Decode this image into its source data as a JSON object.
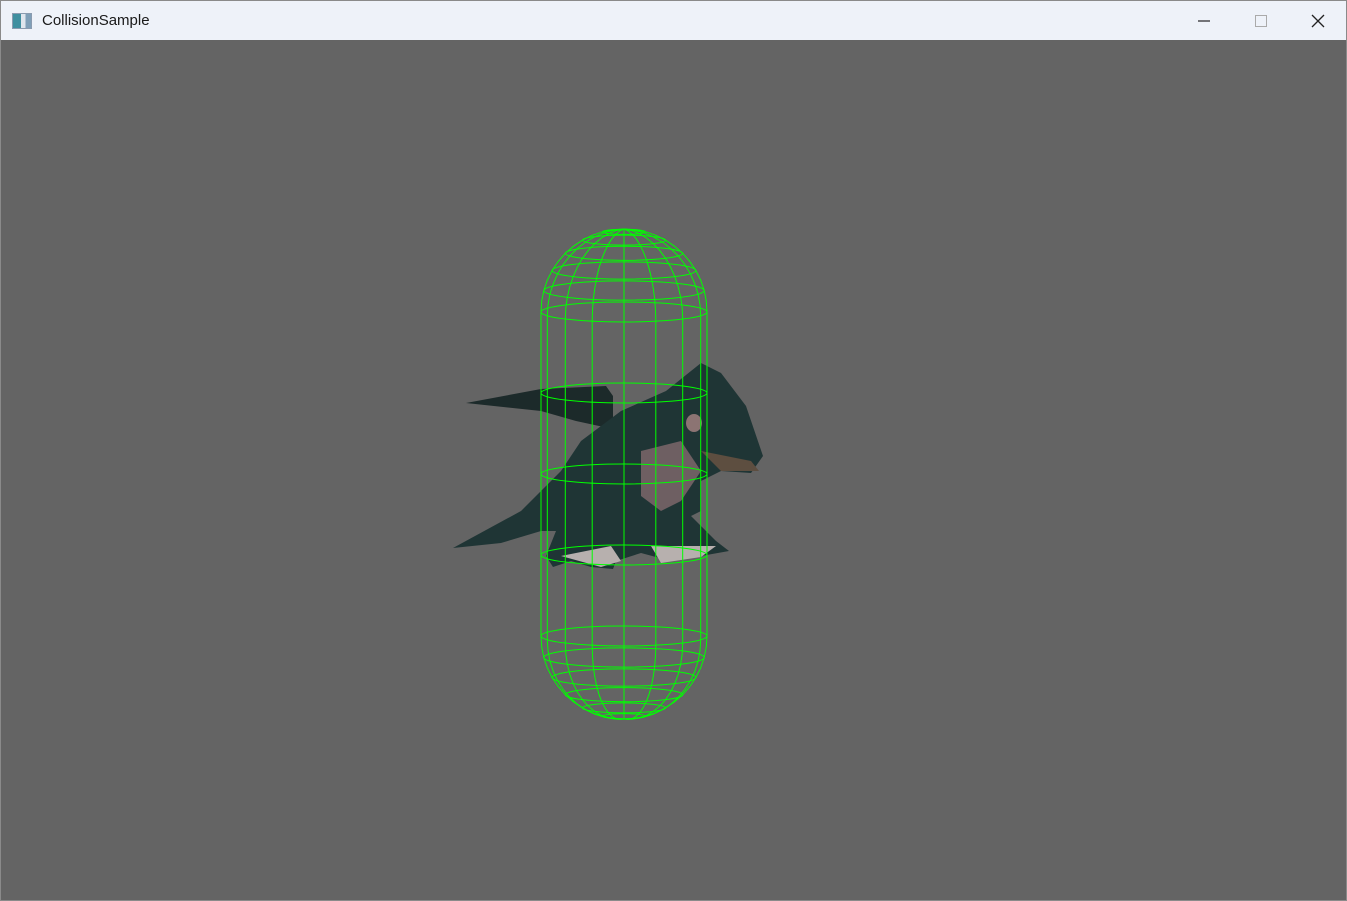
{
  "window": {
    "title": "CollisionSample",
    "icon": "app-window-icon"
  },
  "controls": {
    "minimize": "minimize-icon",
    "maximize": "maximize-icon",
    "close": "close-icon"
  },
  "scene": {
    "background": "#646464",
    "wireframe_color": "#00ff00",
    "collider": "capsule",
    "model": "dragon"
  }
}
